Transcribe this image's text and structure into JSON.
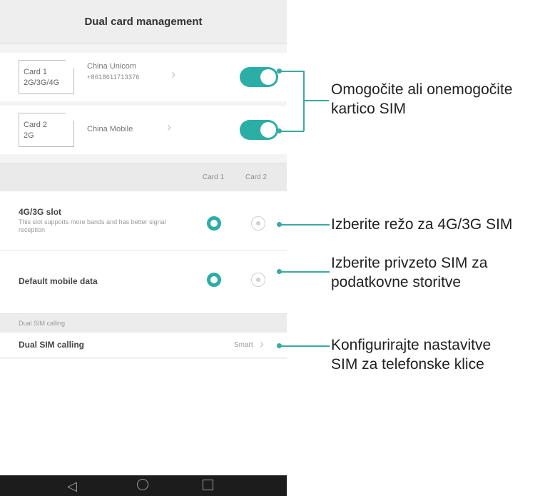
{
  "screen": {
    "title": "Dual card management",
    "cards": [
      {
        "slot_label": "Card 1",
        "network": "2G/3G/4G",
        "carrier": "China Unicom",
        "number": "+8618611713376",
        "enabled": true
      },
      {
        "slot_label": "Card 2",
        "network": "2G",
        "carrier": "China Mobile",
        "number": "",
        "enabled": true
      }
    ],
    "columns": [
      "Card 1",
      "Card 2"
    ],
    "slot_setting": {
      "title": "4G/3G slot",
      "description": "This slot supports more bands and has better signal reception",
      "selected": "Card 1"
    },
    "mobile_data": {
      "title": "Default mobile data",
      "selected": "Card 1"
    },
    "calling_section": {
      "header": "Dual SIM calling",
      "title": "Dual SIM calling",
      "value": "Smart"
    }
  },
  "callouts": [
    {
      "line1": "Omogočite ali onemogočite",
      "line2": "kartico SIM"
    },
    {
      "line1": "Izberite režo za 4G/3G SIM",
      "line2": ""
    },
    {
      "line1": "Izberite privzeto SIM za",
      "line2": "podatkovne storitve"
    },
    {
      "line1": "Konfigurirajte nastavitve",
      "line2": "SIM za telefonske klice"
    }
  ],
  "colors": {
    "accent": "#2baea6",
    "leader": "#3aa9a3"
  },
  "icons": [
    "chevron-right-icon",
    "back-icon",
    "home-icon",
    "recents-icon"
  ]
}
